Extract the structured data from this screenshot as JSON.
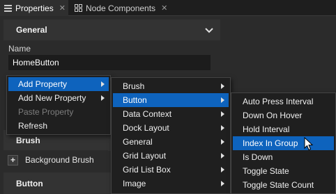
{
  "tabs": [
    {
      "label": "Properties",
      "active": true,
      "icon": "properties-icon",
      "has_close": true
    },
    {
      "label": "Node Components",
      "active": false,
      "icon": "components-icon",
      "has_close": true
    }
  ],
  "panel": {
    "section_general": "General",
    "name_label": "Name",
    "name_value": "HomeButton",
    "section_brush": "Brush",
    "background_brush_label": "Background Brush",
    "section_button": "Button"
  },
  "context_menu": {
    "items": [
      {
        "label": "Add Property",
        "highlighted": true,
        "submenu": true,
        "enabled": true
      },
      {
        "label": "Add New Property",
        "highlighted": false,
        "submenu": true,
        "enabled": true
      },
      {
        "label": "Paste Property",
        "highlighted": false,
        "submenu": false,
        "enabled": false
      },
      {
        "label": "Refresh",
        "highlighted": false,
        "submenu": false,
        "enabled": true
      }
    ]
  },
  "category_menu": {
    "items": [
      {
        "label": "Brush",
        "highlighted": false
      },
      {
        "label": "Button",
        "highlighted": true
      },
      {
        "label": "Data Context",
        "highlighted": false
      },
      {
        "label": "Dock Layout",
        "highlighted": false
      },
      {
        "label": "General",
        "highlighted": false
      },
      {
        "label": "Grid Layout",
        "highlighted": false
      },
      {
        "label": "Grid List Box",
        "highlighted": false
      },
      {
        "label": "Image",
        "highlighted": false
      }
    ]
  },
  "button_menu": {
    "items": [
      {
        "label": "Auto Press Interval",
        "highlighted": false
      },
      {
        "label": "Down On Hover",
        "highlighted": false
      },
      {
        "label": "Hold Interval",
        "highlighted": false
      },
      {
        "label": "Index In Group",
        "highlighted": true
      },
      {
        "label": "Is Down",
        "highlighted": false
      },
      {
        "label": "Toggle State",
        "highlighted": false
      },
      {
        "label": "Toggle State Count",
        "highlighted": false
      }
    ]
  },
  "colors": {
    "highlight": "#0e63bd",
    "menu_bg": "#1f1f1f",
    "panel_bg": "#2b2b2b",
    "header_bg": "#333333"
  }
}
